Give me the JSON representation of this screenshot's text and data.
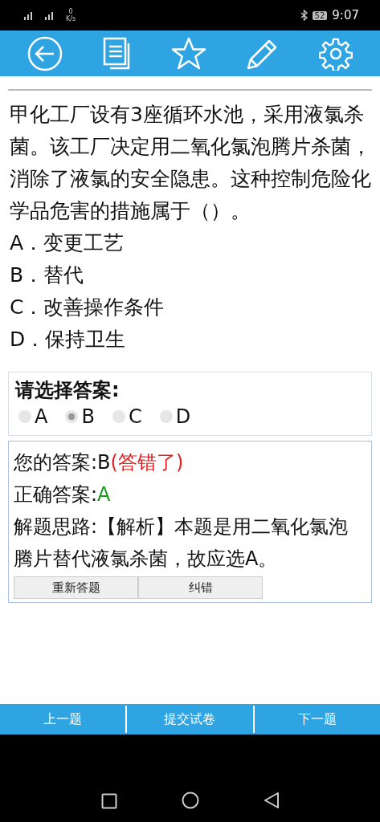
{
  "status_bar": {
    "speed_value": "0",
    "speed_unit": "K/s",
    "battery": "52",
    "time": "9:07"
  },
  "toolbar": {
    "buttons": [
      {
        "kind": "back"
      },
      {
        "kind": "list"
      },
      {
        "kind": "star"
      },
      {
        "kind": "pencil"
      },
      {
        "kind": "settings"
      }
    ]
  },
  "question": {
    "text": "甲化工厂设有3座循环水池，采用液氯杀菌。该工厂决定用二氧化氯泡腾片杀菌，消除了液氯的安全隐患。这种控制危险化学品危害的措施属于（）。",
    "options": [
      "A．变更工艺",
      "B．替代",
      "C．改善操作条件",
      "D．保持卫生"
    ]
  },
  "answer_panel": {
    "title": "请选择答案:",
    "choices": [
      {
        "label": "A",
        "selected": false
      },
      {
        "label": "B",
        "selected": true
      },
      {
        "label": "C",
        "selected": false
      },
      {
        "label": "D",
        "selected": false
      }
    ]
  },
  "result": {
    "your_answer_label": "您的答案:",
    "your_answer": "B",
    "verdict": "(答错了)",
    "correct_label": "正确答案:",
    "correct_answer": "A",
    "explanation": "解题思路:【解析】本题是用二氧化氯泡腾片替代液氯杀菌，故应选A。",
    "buttons": [
      "重新答题",
      "纠错"
    ]
  },
  "bottom_bar": [
    "上一题",
    "提交试卷",
    "下一题"
  ],
  "nav_bar": [
    {
      "kind": "recents"
    },
    {
      "kind": "home"
    },
    {
      "kind": "back"
    }
  ]
}
